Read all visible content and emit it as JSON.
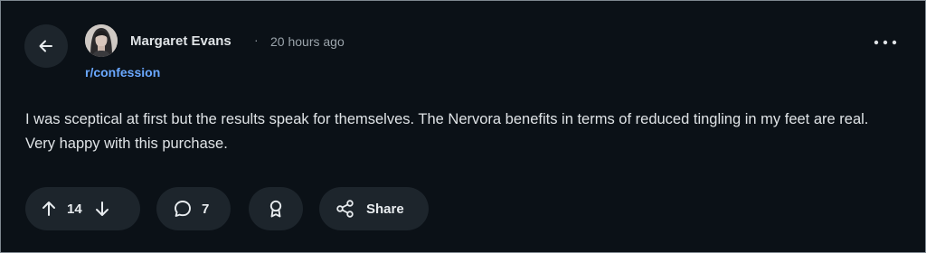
{
  "post": {
    "author": "Margaret Evans",
    "separator": "·",
    "time": "20 hours ago",
    "subreddit": "r/confession",
    "body": "I was sceptical at first but the results speak for themselves. The Nervora benefits in terms of reduced tingling in my feet are real. Very happy with this purchase."
  },
  "actions": {
    "upvote_count": "14",
    "comment_count": "7",
    "share_label": "Share"
  },
  "icons": {
    "back": "arrow-left-icon",
    "more": "more-horizontal-icon",
    "upvote": "arrow-up-icon",
    "downvote": "arrow-down-icon",
    "comment": "speech-bubble-icon",
    "award": "award-ribbon-icon",
    "share": "share-nodes-icon"
  },
  "colors": {
    "background": "#0b1117",
    "surface": "#1d252c",
    "text": "#dfe3e6",
    "muted": "#9ba4ab",
    "link": "#6aa8ff"
  }
}
